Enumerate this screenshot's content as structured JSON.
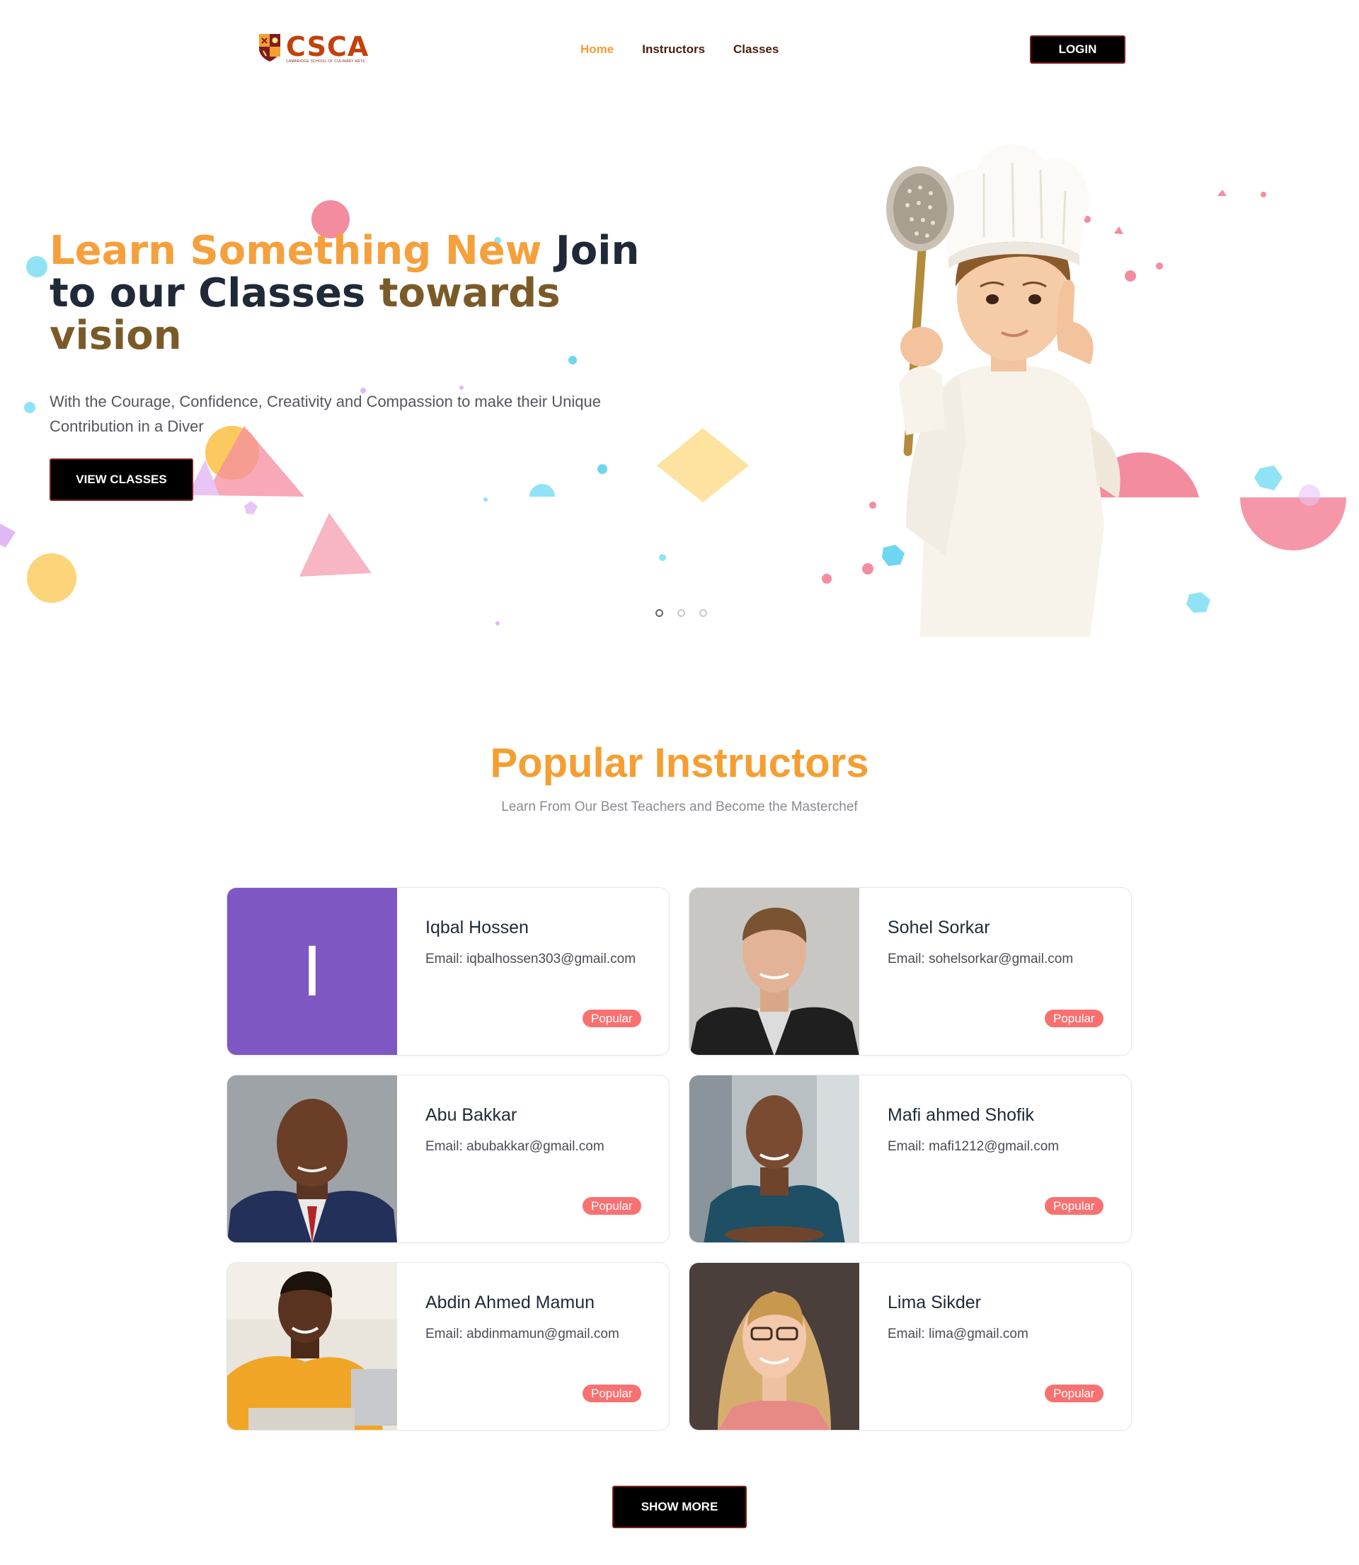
{
  "nav": {
    "logo_text": "CSCA",
    "logo_tagline": "Cambridge School of Culinary Arts",
    "links": [
      {
        "label": "Home",
        "active": true
      },
      {
        "label": "Instructors",
        "active": false
      },
      {
        "label": "Classes",
        "active": false
      }
    ],
    "login_label": "LOGIN"
  },
  "hero": {
    "title_orange": "Learn Something New",
    "title_dark": " Join to our Classes",
    "title_brown": " towards vision",
    "subtitle": "With the Courage, Confidence, Creativity and Compassion to make their Unique Contribution in a Diver",
    "button_label": "VIEW CLASSES",
    "slide_count": 3,
    "active_slide": 1
  },
  "instructors": {
    "title": "Popular Instructors",
    "subtitle": "Learn From Our Best Teachers and Become the Masterchef",
    "items": [
      {
        "name": "Iqbal Hossen",
        "email": "Email: iqbalhossen303@gmail.com",
        "badge": "Popular",
        "initial": "I"
      },
      {
        "name": "Sohel Sorkar",
        "email": "Email: sohelsorkar@gmail.com",
        "badge": "Popular"
      },
      {
        "name": "Abu Bakkar",
        "email": "Email: abubakkar@gmail.com",
        "badge": "Popular"
      },
      {
        "name": "Mafi ahmed Shofik",
        "email": "Email: mafi1212@gmail.com",
        "badge": "Popular"
      },
      {
        "name": "Abdin Ahmed Mamun",
        "email": "Email: abdinmamun@gmail.com",
        "badge": "Popular"
      },
      {
        "name": "Lima Sikder",
        "email": "Email: lima@gmail.com",
        "badge": "Popular"
      }
    ],
    "show_more_label": "SHOW MORE"
  },
  "colors": {
    "accent_orange": "#f59e32",
    "badge_red": "#f87171",
    "button_black": "#000000",
    "avatar_purple": "#7e57c2"
  }
}
